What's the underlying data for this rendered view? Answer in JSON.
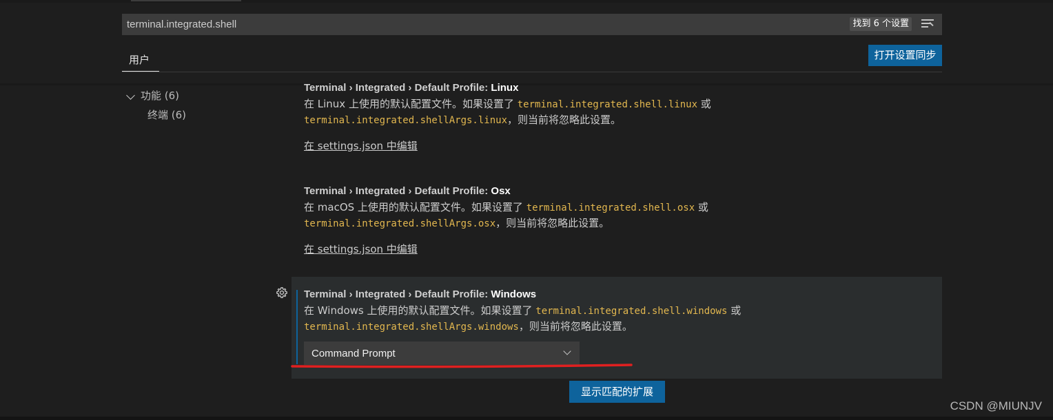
{
  "search": {
    "query": "terminal.integrated.shell",
    "result_count_label": "找到 6 个设置",
    "filter_icon": "filter-list-icon"
  },
  "scope_tabs": [
    {
      "label": "用户",
      "active": true
    }
  ],
  "sync_button_label": "打开设置同步",
  "toc": {
    "items": [
      {
        "label": "功能 (6)",
        "expanded": true,
        "icon": "chevron-down-icon"
      },
      {
        "label": "终端 (6)"
      }
    ]
  },
  "settings": [
    {
      "title_prefix": "Terminal › Integrated › Default Profile: ",
      "title_key": "Linux",
      "desc_pre": "在 Linux 上使用的默认配置文件。如果设置了 ",
      "code1": "terminal.integrated.shell.linux",
      "desc_mid": " 或",
      "code2": "terminal.integrated.shellArgs.linux",
      "desc_post": "，则当前将忽略此设置。",
      "edit_link": "在 settings.json 中编辑"
    },
    {
      "title_prefix": "Terminal › Integrated › Default Profile: ",
      "title_key": "Osx",
      "desc_pre": "在 macOS 上使用的默认配置文件。如果设置了 ",
      "code1": "terminal.integrated.shell.osx",
      "desc_mid": " 或",
      "code2": "terminal.integrated.shellArgs.osx",
      "desc_post": "，则当前将忽略此设置。",
      "edit_link": "在 settings.json 中编辑"
    },
    {
      "title_prefix": "Terminal › Integrated › Default Profile: ",
      "title_key": "Windows",
      "desc_pre": "在 Windows 上使用的默认配置文件。如果设置了 ",
      "code1": "terminal.integrated.shell.windows",
      "desc_mid": " 或",
      "code2": "terminal.integrated.shellArgs.windows",
      "desc_post": "，则当前将忽略此设置。",
      "select_value": "Command Prompt",
      "focused": true
    }
  ],
  "show_extensions_button_label": "显示匹配的扩展",
  "watermark": "CSDN @MIUNJV",
  "colors": {
    "accent_button": "#0e639c",
    "code_text": "#e2b74f",
    "annotation_red": "#e02020"
  }
}
